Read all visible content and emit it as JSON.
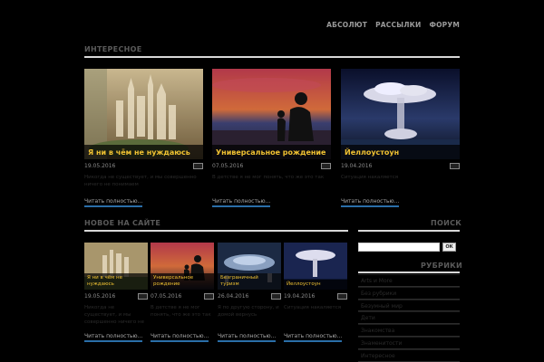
{
  "nav": {
    "items": [
      "АБСОЛЮТ",
      "РАССЫЛКИ",
      "ФОРУМ"
    ]
  },
  "featured": {
    "title": "ИНТЕРЕСНОЕ",
    "cards": [
      {
        "title": "Я ни в чём не нуждаюсь",
        "date": "19.05.2016",
        "comments": "",
        "excerpt": "Никогда не существует, и мы совершенно ничего не понимаем",
        "more": "Читать полностью..."
      },
      {
        "title": "Универсальное рождение",
        "date": "07.05.2016",
        "comments": "",
        "excerpt": "В детстве я не мог понять, что же это так",
        "more": "Читать полностью..."
      },
      {
        "title": "Йеллоустоун",
        "date": "19.04.2016",
        "comments": "",
        "excerpt": "Ситуация накаляется",
        "more": "Читать полностью..."
      }
    ]
  },
  "latest": {
    "title": "НОВОЕ НА САЙТЕ",
    "cards": [
      {
        "title": "Я ни в чём не нуждаюсь",
        "date": "19.05.2016",
        "comments": "",
        "excerpt": "Никогда не существует, и мы совершенно ничего не понимаем",
        "more": "Читать полностью..."
      },
      {
        "title": "Универсальное рождение",
        "date": "07.05.2016",
        "comments": "",
        "excerpt": "В детстве я не мог понять, что же это так",
        "more": "Читать полностью..."
      },
      {
        "title": "Безграничный туризм",
        "date": "26.04.2016",
        "comments": "",
        "excerpt": "Я по другую сторону, и домой вернусь",
        "more": "Читать полностью..."
      },
      {
        "title": "Йеллоустоун",
        "date": "19.04.2016",
        "comments": "",
        "excerpt": "Ситуация накаляется",
        "more": "Читать полностью..."
      }
    ]
  },
  "sidebar": {
    "search_title": "ПОИСК",
    "search_button": "ОК",
    "rubrics_title": "РУБРИКИ",
    "categories": [
      "Arts и More",
      "Без рубрики",
      "Безумный мир",
      "Дети",
      "Знакомства",
      "Знаменитости",
      "Интересное"
    ]
  },
  "colors": {
    "accent": "#f1c232",
    "link_underline": "#2a6ea8",
    "rule": "#d8d8d8"
  }
}
